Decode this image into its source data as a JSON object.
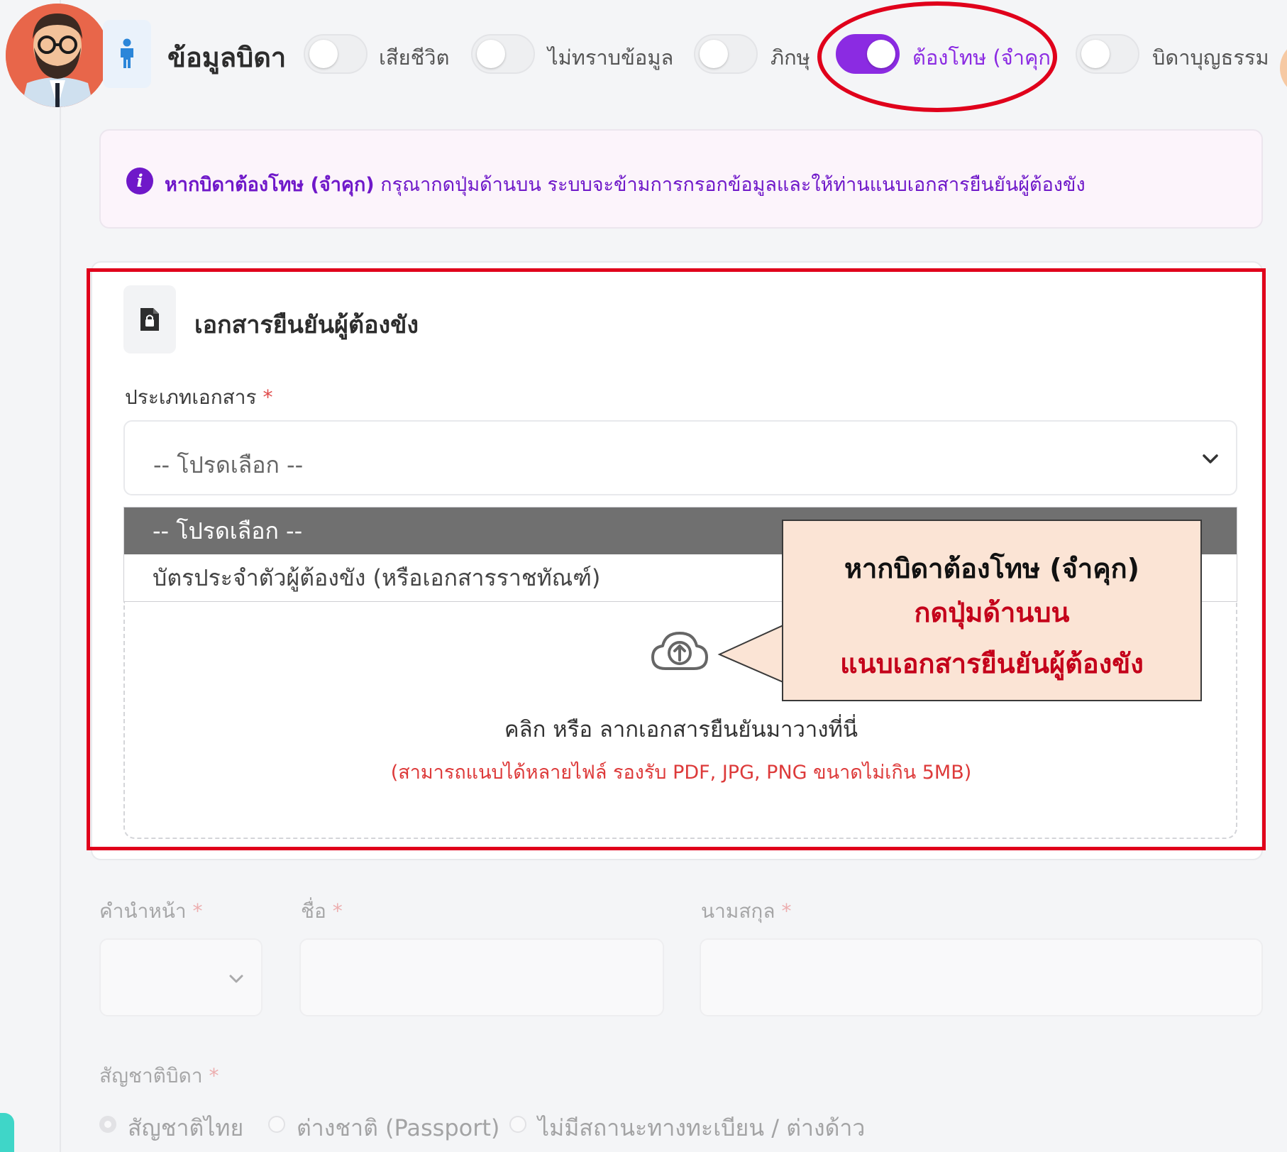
{
  "header": {
    "title": "ข้อมูลบิดา",
    "toggles": [
      {
        "label": "เสียชีวิต",
        "on": false
      },
      {
        "label": "ไม่ทราบข้อมูล",
        "on": false
      },
      {
        "label": "ภิกษุ",
        "on": false
      },
      {
        "label": "ต้องโทษ (จำคุก)",
        "on": true
      },
      {
        "label": "บิดาบุญธรรม",
        "on": false
      }
    ]
  },
  "alert": {
    "strong": "หากบิดาต้องโทษ (จำคุก)",
    "text": " กรุณากดปุ่มด้านบน ระบบจะข้ามการกรอกข้อมูลและให้ท่านแนบเอกสารยืนยันผู้ต้องขัง"
  },
  "doc_section": {
    "title": "เอกสารยืนยันผู้ต้องขัง",
    "doc_type_label": "ประเภทเอกสาร",
    "required_mark": "*",
    "select_value": "-- โปรดเลือก --",
    "options": [
      "-- โปรดเลือก --",
      "บัตรประจำตัวผู้ต้องขัง (หรือเอกสารราชทัณฑ์)"
    ],
    "upload_main": "คลิก หรือ ลากเอกสารยืนยันมาวางที่นี่",
    "upload_hint": "(สามารถแนบได้หลายไฟล์ รองรับ PDF, JPG, PNG ขนาดไม่เกิน 5MB)"
  },
  "callout": {
    "line1": "หากบิดาต้องโทษ (จำคุก)",
    "line2": "กดปุ่มด้านบน",
    "line3": "แนบเอกสารยืนยันผู้ต้องขัง"
  },
  "form": {
    "prefix_label": "คำนำหน้า",
    "first_name_label": "ชื่อ",
    "last_name_label": "นามสกุล",
    "nationality_label": "สัญชาติบิดา",
    "required_mark": "*",
    "nationality_options": [
      {
        "label": "สัญชาติไทย",
        "checked": true
      },
      {
        "label": "ต่างชาติ (Passport)",
        "checked": false
      },
      {
        "label": "ไม่มีสถานะทางทะเบียน / ต่างด้าว",
        "checked": false
      }
    ]
  },
  "colors": {
    "accent_purple": "#8b2be2",
    "annotation_red": "#e0001b",
    "callout_fill": "#fbe4d5"
  },
  "icons": [
    "user-avatar",
    "person-icon",
    "info-icon",
    "document-lock-icon",
    "chevron-down-icon",
    "cloud-upload-icon"
  ]
}
